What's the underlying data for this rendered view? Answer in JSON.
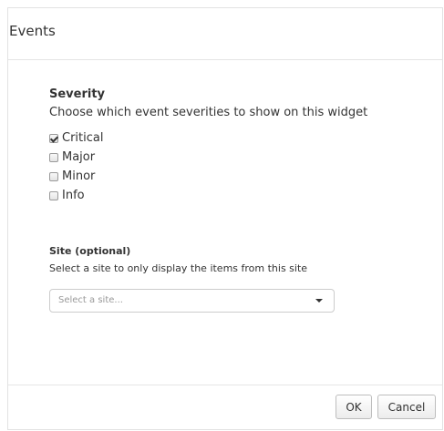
{
  "dialog": {
    "title": "Events"
  },
  "severity": {
    "heading": "Severity",
    "description": "Choose which event severities to show on this widget",
    "options": [
      {
        "label": "Critical",
        "checked": true
      },
      {
        "label": "Major",
        "checked": false
      },
      {
        "label": "Minor",
        "checked": false
      },
      {
        "label": "Info",
        "checked": false
      }
    ]
  },
  "site": {
    "heading": "Site (optional)",
    "description": "Select a site to only display the items from this site",
    "placeholder": "Select a site..."
  },
  "footer": {
    "ok_label": "OK",
    "cancel_label": "Cancel"
  }
}
